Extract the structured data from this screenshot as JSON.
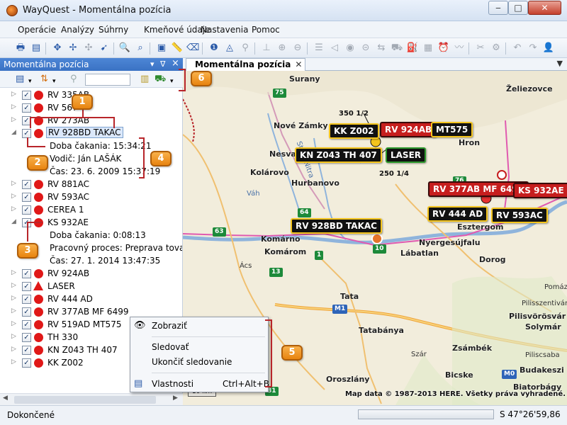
{
  "window": {
    "title": "WayQuest - Momentálna pozícia",
    "min_label": "‒",
    "max_label": "□",
    "close_label": "✕"
  },
  "menu": [
    "Operácie",
    "Analýzy",
    "Súhrny",
    "Kmeňové údaje",
    "Nastavenia",
    "Pomoc"
  ],
  "panel": {
    "title": "Momentálna pozícia",
    "pin_label": "ᐁ",
    "close_label": "×",
    "filter_value": ""
  },
  "tab": {
    "label": "Momentálna pozícia",
    "close_label": "✕",
    "menu_label": "▼"
  },
  "tree": {
    "checkmark": "✓",
    "expand_glyph": "▷",
    "collapse_glyph": "◢",
    "vehicles_top": [
      "RV 335AB",
      "RV 567",
      "RV 273AB"
    ],
    "selected": {
      "name": "RV 928BD TAKAC",
      "wait": "Doba čakania: 15:34:21",
      "driver": "Vodič: Ján LAŠÁK",
      "time": "Čas: 23. 6. 2009 15:37:19"
    },
    "vehicles_mid": [
      "RV 881AC",
      "RV 593AC",
      "CEREA 1"
    ],
    "expanded": {
      "name": "KS 932AE",
      "wait": "Doba čakania: 0:08:13",
      "process": "Pracovný proces: Preprava tovaru",
      "time": "Čas: 27. 1. 2014 13:47:35"
    },
    "vehicles_bottom": [
      "RV 924AB",
      "LASER",
      "RV 444 AD",
      "RV 377AB MF 6499",
      "RV 519AD MT575",
      "TH 330",
      "KN Z043 TH 407",
      "KK Z002"
    ]
  },
  "callouts": [
    "1",
    "2",
    "3",
    "4",
    "5",
    "6"
  ],
  "context_menu": {
    "items": [
      {
        "label": "Zobraziť",
        "shortcut": ""
      },
      {
        "label": "Sledovať",
        "shortcut": ""
      },
      {
        "label": "Ukončiť sledovanie",
        "shortcut": ""
      },
      {
        "label": "Vlastnosti",
        "shortcut": "Ctrl+Alt+B"
      }
    ]
  },
  "map": {
    "labels": {
      "kk": "KK Z002",
      "rv924": "RV 924AB",
      "mt575": "MT575",
      "kn": "KN Z043 TH 407",
      "laser": "LASER",
      "rv377": "RV 377AB MF 6499",
      "ks932": "KS 932AE",
      "rv444": "RV 444 AD",
      "rv593": "RV 593AC",
      "rv928": "RV 928BD TAKAC"
    },
    "towns": [
      "Surany",
      "Nové Zámky",
      "Želiezovce",
      "Nesvad",
      "Kolárovo",
      "Hurbanovo",
      "Hron",
      "Komárno",
      "Komárom",
      "Nyergesújfalu",
      "Esztergom",
      "Lábatlan",
      "Dorog",
      "Tata",
      "Tatabánya",
      "Oroszlány",
      "Bicske",
      "Biatorbágy",
      "Budakeszi",
      "Zsámbék",
      "Pilisvörösvár",
      "Solymár",
      "Pilisszentiván",
      "Piliscsaba",
      "Ács",
      "Váh",
      "Stará Nitra",
      "Pomáz",
      "Szár"
    ],
    "road_numbers": [
      "75",
      "76",
      "64",
      "63",
      "10",
      "1",
      "13",
      "M1",
      "81",
      "M0"
    ],
    "markers": [
      "350 1/2",
      "250 1/4"
    ],
    "scale_label": "10 km",
    "copyright": "Map data © 1987-2013 HERE. Všetky práva vyhradené."
  },
  "status": {
    "text": "Dokončené",
    "coords": "S 47°26'59,86"
  }
}
